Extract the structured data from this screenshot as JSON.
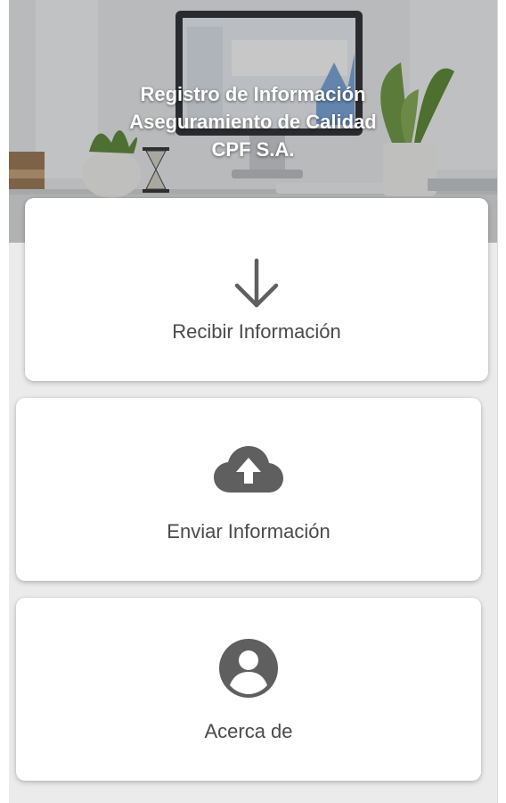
{
  "header": {
    "title_lines": [
      "Registro de Información",
      "Aseguramiento de Calidad",
      "CPF S.A."
    ],
    "background": "office-desk-photo"
  },
  "menu": {
    "items": [
      {
        "label": "Recibir Información",
        "icon": "arrow-down-icon"
      },
      {
        "label": "Enviar Información",
        "icon": "cloud-upload-icon"
      },
      {
        "label": "Acerca de",
        "icon": "account-circle-icon"
      }
    ]
  },
  "colors": {
    "icon": "#5f5f5f",
    "label": "#4a4a4a",
    "card": "#ffffff",
    "background": "#ebebeb",
    "title": "#ffffff"
  }
}
